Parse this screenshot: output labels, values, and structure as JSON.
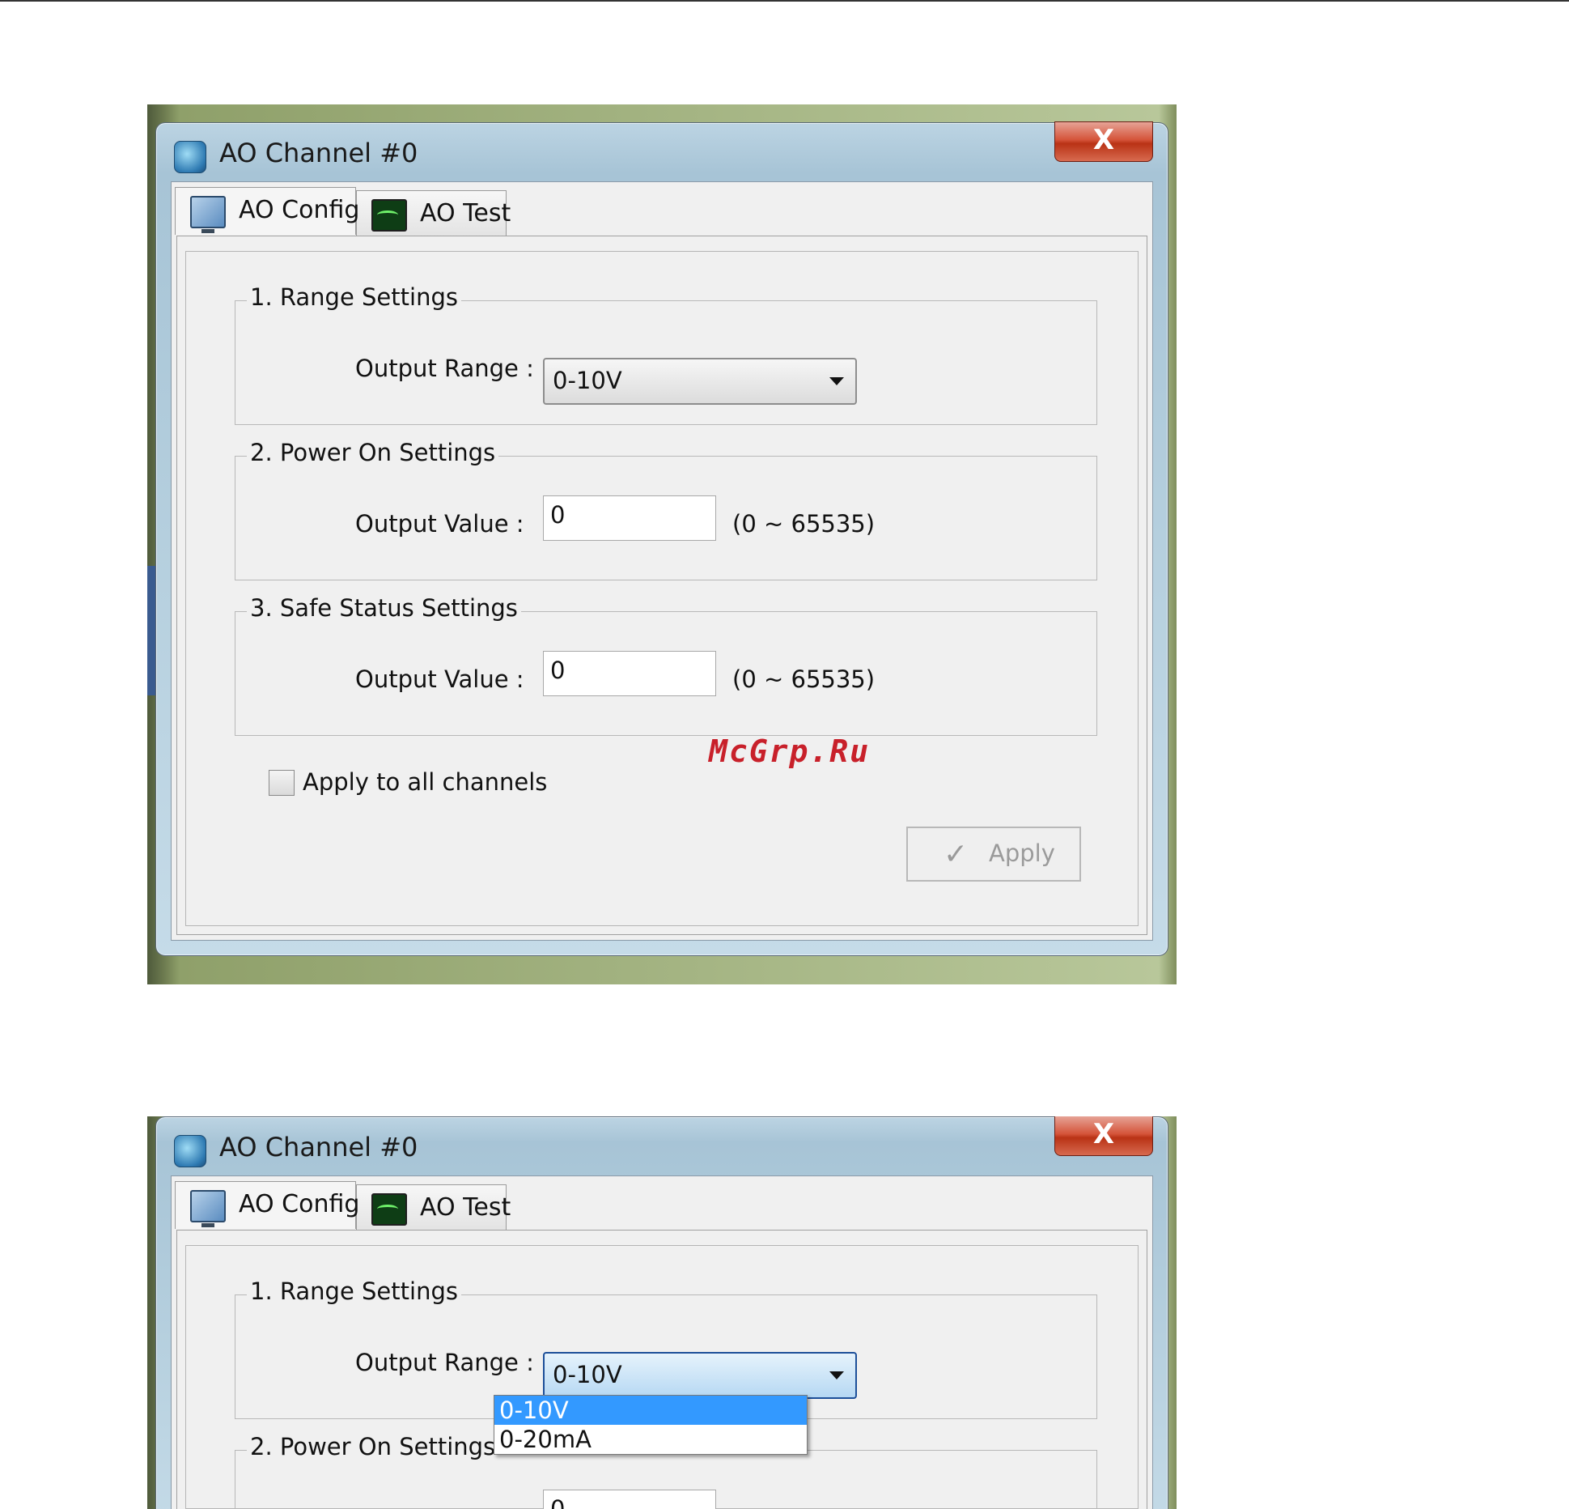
{
  "screenshots": [
    {
      "window": {
        "title": "AO Channel #0",
        "close_label": "X"
      },
      "tabs": {
        "config": "AO Config",
        "test": "AO Test"
      },
      "range_settings": {
        "legend": "1. Range Settings",
        "label": "Output Range :",
        "value": "0-10V"
      },
      "power_on_settings": {
        "legend": "2. Power On Settings",
        "label": "Output Value :",
        "value": "0",
        "hint": "(0 ~ 65535)"
      },
      "safe_status_settings": {
        "legend": "3. Safe Status Settings",
        "label": "Output Value :",
        "value": "0",
        "hint": "(0 ~ 65535)"
      },
      "apply_all": {
        "label": "Apply to all channels",
        "checked": false
      },
      "apply_button": {
        "label": "Apply"
      }
    },
    {
      "window": {
        "title": "AO Channel #0",
        "close_label": "X"
      },
      "tabs": {
        "config": "AO Config",
        "test": "AO Test"
      },
      "range_settings": {
        "legend": "1. Range Settings",
        "label": "Output Range :",
        "value": "0-10V",
        "options": [
          "0-10V",
          "0-20mA"
        ],
        "selected_option": "0-10V"
      },
      "power_on_settings": {
        "legend": "2. Power On Settings",
        "value": "0"
      }
    }
  ],
  "watermark": "McGrp.Ru",
  "icons": {
    "app": "app-globe-icon",
    "config_tab": "monitor-config-icon",
    "test_tab": "oscilloscope-icon",
    "apply": "checkmark-icon",
    "dropdown": "chevron-down-icon"
  },
  "colors": {
    "selection": "#3399ff",
    "close_button": "#c9432a",
    "watermark": "#c8202a"
  }
}
